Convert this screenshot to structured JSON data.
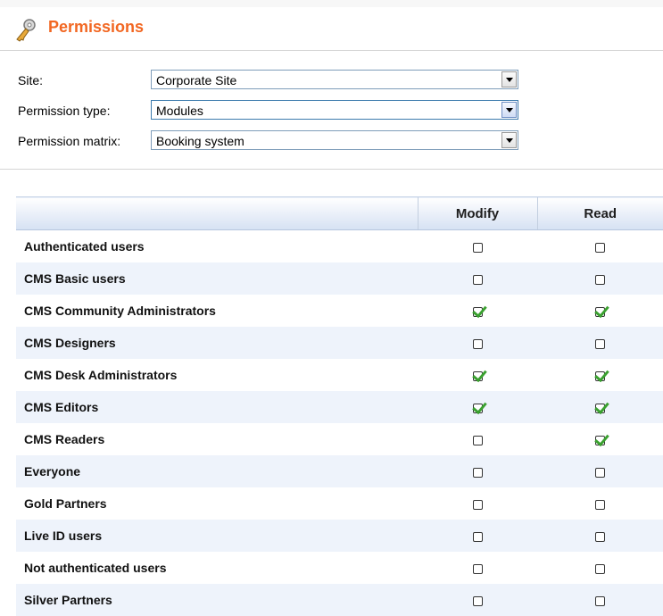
{
  "header": {
    "title": "Permissions",
    "icon": "key-icon"
  },
  "form": {
    "site": {
      "label": "Site:",
      "value": "Corporate Site"
    },
    "permission_type": {
      "label": "Permission type:",
      "value": "Modules"
    },
    "permission_matrix": {
      "label": "Permission matrix:",
      "value": "Booking system"
    }
  },
  "grid": {
    "columns": [
      "",
      "Modify",
      "Read"
    ],
    "rows": [
      {
        "name": "Authenticated users",
        "modify": false,
        "read": false
      },
      {
        "name": "CMS Basic users",
        "modify": false,
        "read": false
      },
      {
        "name": "CMS Community Administrators",
        "modify": true,
        "read": true
      },
      {
        "name": "CMS Designers",
        "modify": false,
        "read": false
      },
      {
        "name": "CMS Desk Administrators",
        "modify": true,
        "read": true
      },
      {
        "name": "CMS Editors",
        "modify": true,
        "read": true
      },
      {
        "name": "CMS Readers",
        "modify": false,
        "read": true
      },
      {
        "name": "Everyone",
        "modify": false,
        "read": false
      },
      {
        "name": "Gold Partners",
        "modify": false,
        "read": false
      },
      {
        "name": "Live ID users",
        "modify": false,
        "read": false
      },
      {
        "name": "Not authenticated users",
        "modify": false,
        "read": false
      },
      {
        "name": "Silver Partners",
        "modify": false,
        "read": false
      }
    ]
  },
  "colors": {
    "title": "#f26722",
    "check": "#3aa02f",
    "alt_row": "#eef3fb"
  }
}
